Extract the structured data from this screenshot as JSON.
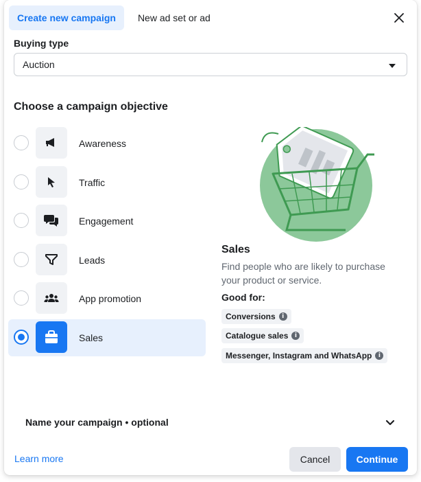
{
  "tabs": {
    "create": "Create new campaign",
    "existing": "New ad set or ad"
  },
  "buying_type": {
    "label": "Buying type",
    "value": "Auction"
  },
  "objectives": {
    "title": "Choose a campaign objective",
    "items": [
      {
        "label": "Awareness",
        "icon": "megaphone-icon",
        "selected": false
      },
      {
        "label": "Traffic",
        "icon": "cursor-icon",
        "selected": false
      },
      {
        "label": "Engagement",
        "icon": "chat-bubbles-icon",
        "selected": false
      },
      {
        "label": "Leads",
        "icon": "funnel-icon",
        "selected": false
      },
      {
        "label": "App promotion",
        "icon": "people-icon",
        "selected": false
      },
      {
        "label": "Sales",
        "icon": "shopping-bag-icon",
        "selected": true
      }
    ]
  },
  "detail": {
    "title": "Sales",
    "description": "Find people who are likely to purchase your product or service.",
    "good_for_label": "Good for:",
    "good_for": [
      "Conversions",
      "Catalogue sales",
      "Messenger, Instagram and WhatsApp"
    ]
  },
  "name_campaign": {
    "label": "Name your campaign • optional"
  },
  "footer": {
    "learn_more": "Learn more",
    "cancel": "Cancel",
    "continue": "Continue"
  },
  "colors": {
    "accent": "#1877f2",
    "selected_bg": "#e7f0fd",
    "illustration_green": "#8cc89a"
  }
}
